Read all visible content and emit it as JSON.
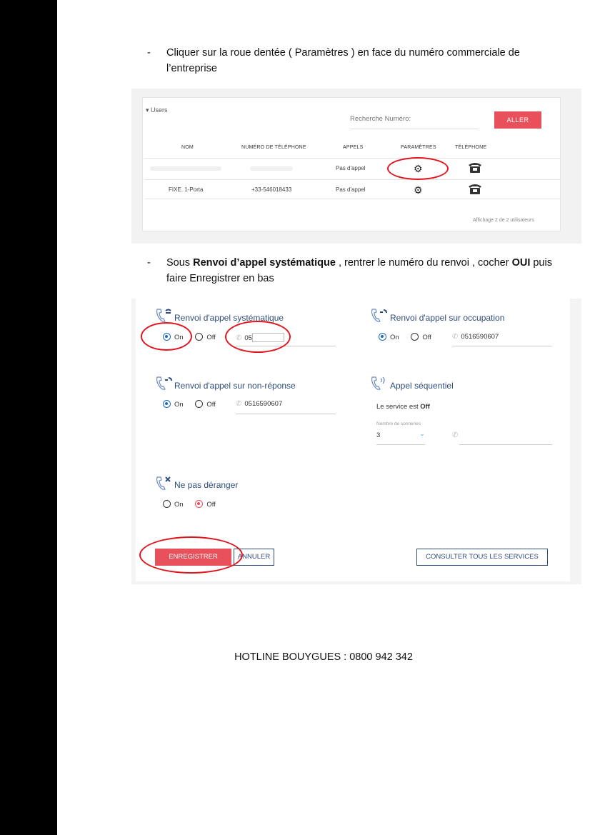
{
  "instructions": {
    "step1_dash": "-",
    "step1_line1": "Cliquer sur la roue dentée ( Paramètres ) en face du numéro commerciale de",
    "step1_line2": "l’entreprise",
    "step2_dash": "-",
    "step2_pre": "Sous ",
    "step2_bold1": "Renvoi d’appel systématique",
    "step2_mid": " , rentrer le numéro du renvoi , cocher ",
    "step2_bold2": "OUI",
    "step2_post": " puis",
    "step2_line2": "faire Enregistrer en bas"
  },
  "users_panel": {
    "section_label": "Users",
    "search_label": "Recherche Numéro:",
    "search_button": "ALLER",
    "columns": [
      "NOM",
      "NUMÉRO DE TÉLÉPHONE",
      "APPELS",
      "PARAMÈTRES",
      "TÉLÉPHONE"
    ],
    "rows": [
      {
        "nom": "",
        "numero": "",
        "appels": "Pas d'appel"
      },
      {
        "nom": "FIXE. 1-Porta",
        "numero": "+33-546018433",
        "appels": "Pas d'appel"
      }
    ],
    "footer": "Affichage 2 de 2 utilisateurs",
    "highlight_color": "#e2151f"
  },
  "settings_panel": {
    "renvoi_systematique": {
      "title": "Renvoi d'appel systématique",
      "on_label": "On",
      "off_label": "Off",
      "selected": "On",
      "number": "05"
    },
    "renvoi_occupation": {
      "title": "Renvoi d'appel sur occupation",
      "on_label": "On",
      "off_label": "Off",
      "selected": "On",
      "number": "0516590607"
    },
    "renvoi_non_reponse": {
      "title": "Renvoi d'appel sur non-réponse",
      "on_label": "On",
      "off_label": "Off",
      "selected": "On",
      "number": "0516590607"
    },
    "appel_sequentiel": {
      "title": "Appel séquentiel",
      "status_pre": "Le service est ",
      "status_value": "Off",
      "rings_label": "Nombre de sonneries",
      "rings_value": "3"
    },
    "ne_pas_deranger": {
      "title": "Ne pas déranger",
      "on_label": "On",
      "off_label": "Off",
      "selected": "Off"
    },
    "buttons": {
      "save": "ENREGISTRER",
      "cancel": "ANNULER",
      "all_services": "CONSULTER TOUS LES SERVICES"
    },
    "accent_color": "#e8505b",
    "title_color": "#2e4d7a"
  },
  "footer": {
    "hotline": "HOTLINE BOUYGUES : 0800 942 342"
  }
}
